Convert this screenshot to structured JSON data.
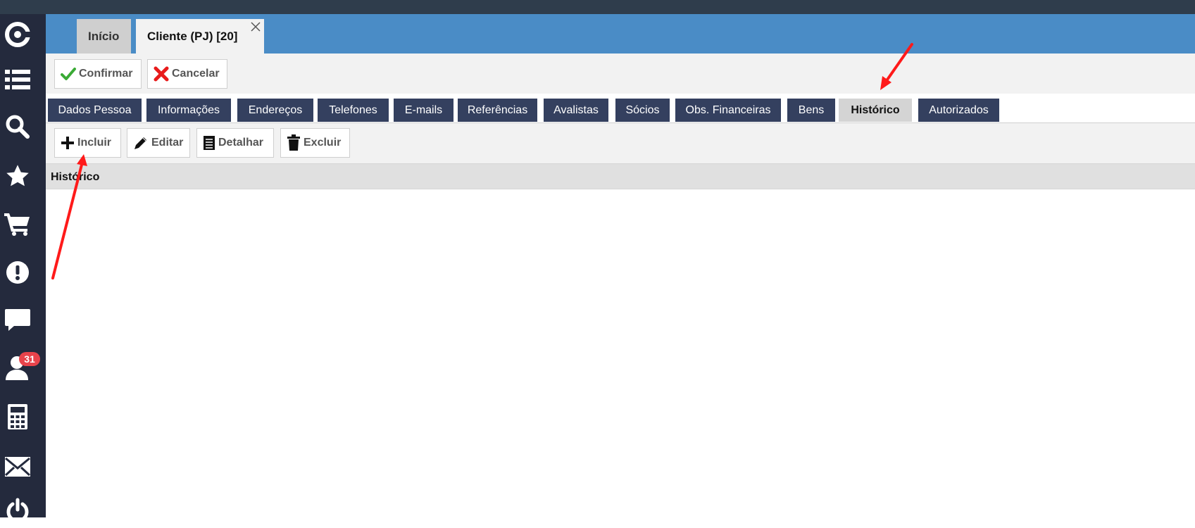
{
  "doc_tabs": [
    {
      "label": "Início",
      "active": false
    },
    {
      "label": "Cliente (PJ) [20]",
      "active": true
    }
  ],
  "sidebar": {
    "items": [
      "logo-icon",
      "list-icon",
      "search-icon",
      "star-icon",
      "cart-icon",
      "alert-icon",
      "chat-icon",
      "user-icon",
      "calculator-icon",
      "mail-icon",
      "power-icon"
    ],
    "notification_count": "31"
  },
  "actions": {
    "confirm": "Confirmar",
    "cancel": "Cancelar"
  },
  "section_tabs": [
    {
      "label": "Dados Pessoa",
      "active": false
    },
    {
      "label": "Informações",
      "active": false
    },
    {
      "label": "Endereços",
      "active": false
    },
    {
      "label": "Telefones",
      "active": false
    },
    {
      "label": "E-mails",
      "active": false
    },
    {
      "label": "Referências",
      "active": false
    },
    {
      "label": "Avalistas",
      "active": false
    },
    {
      "label": "Sócios",
      "active": false
    },
    {
      "label": "Obs. Financeiras",
      "active": false
    },
    {
      "label": "Bens",
      "active": false
    },
    {
      "label": "Histórico",
      "active": true
    },
    {
      "label": "Autorizados",
      "active": false
    }
  ],
  "toolbar": {
    "include": "Incluir",
    "edit": "Editar",
    "detail": "Detalhar",
    "delete": "Excluir"
  },
  "grid": {
    "column": "Histórico"
  },
  "colors": {
    "topbar": "#2f3d4c",
    "sidebar": "#242a3d",
    "tabstrip": "#4a8cc6",
    "section_tab": "#34405f",
    "annotation": "#ff1a1a"
  }
}
